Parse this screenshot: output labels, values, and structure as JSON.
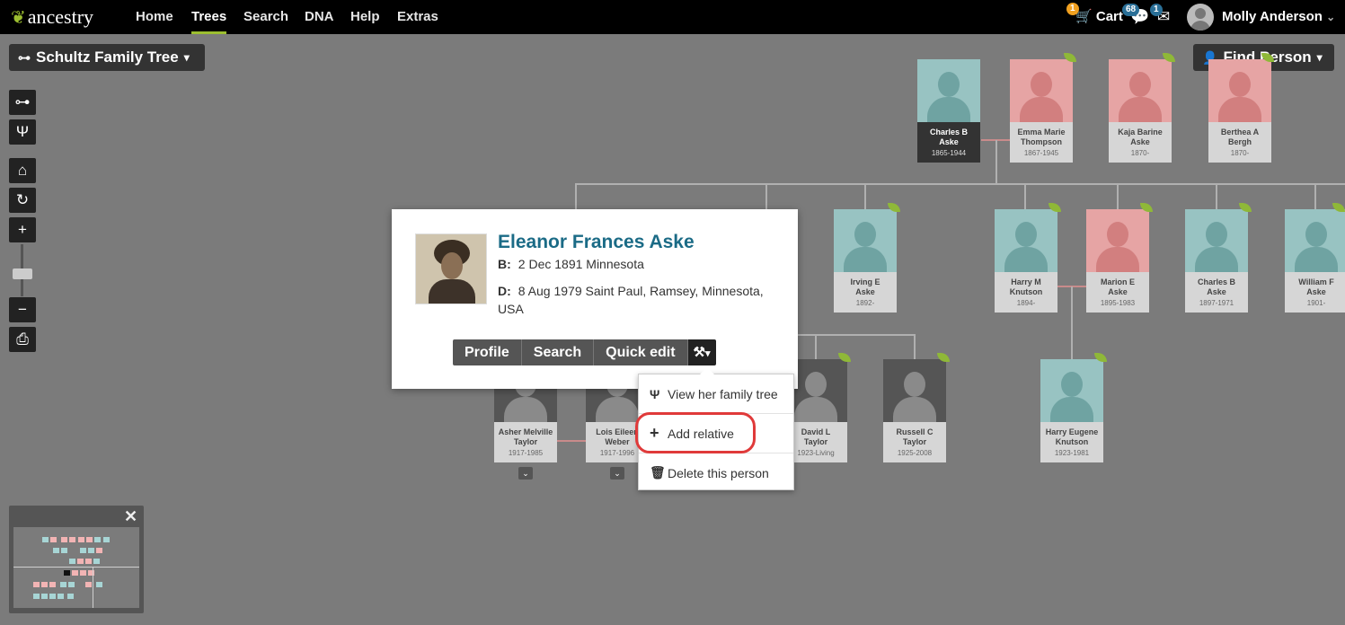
{
  "nav": {
    "logo": "ancestry",
    "links": [
      "Home",
      "Trees",
      "Search",
      "DNA",
      "Help",
      "Extras"
    ],
    "active": "Trees",
    "cart_label": "Cart",
    "cart_count": "1",
    "messages_count": "68",
    "mail_count": "1",
    "user_name": "Molly Anderson"
  },
  "tree_selector": {
    "label": "Schultz Family Tree"
  },
  "find_person": {
    "label": "Find Person"
  },
  "tree_cards": [
    {
      "name": "Charles B\nAske",
      "dates": "1865-1944",
      "gender": "male"
    },
    {
      "name": "Emma Marie\nThompson",
      "dates": "1867-1945",
      "gender": "female"
    },
    {
      "name": "Kaja Barine\nAske",
      "dates": "1870-",
      "gender": "female"
    },
    {
      "name": "Berthea A\nBergh",
      "dates": "1870-",
      "gender": "female"
    },
    {
      "name": "Irving E\nAske",
      "dates": "1892-",
      "gender": "male"
    },
    {
      "name": "Harry M\nKnutson",
      "dates": "1894-",
      "gender": "male"
    },
    {
      "name": "Marion E\nAske",
      "dates": "1895-1983",
      "gender": "female"
    },
    {
      "name": "Charles B\nAske",
      "dates": "1897-1971",
      "gender": "male"
    },
    {
      "name": "William F\nAske",
      "dates": "1901-",
      "gender": "male"
    },
    {
      "name": "Asher Melville\nTaylor",
      "dates": "1917-1985",
      "gender": "photo"
    },
    {
      "name": "Lois Eileen\nWeber",
      "dates": "1917-1996",
      "gender": "photo"
    },
    {
      "name": "David L\nTaylor",
      "dates": "1923-Living",
      "gender": "photo"
    },
    {
      "name": "Russell C\nTaylor",
      "dates": "1925-2008",
      "gender": "photo"
    },
    {
      "name": "Harry Eugene\nKnutson",
      "dates": "1923-1981",
      "gender": "male"
    }
  ],
  "popup": {
    "name": "Eleanor Frances Aske",
    "birth_label": "B:",
    "birth": "2 Dec 1891 Minnesota",
    "death_label": "D:",
    "death": "8 Aug 1979 Saint Paul, Ramsey, Minnesota, USA",
    "actions": [
      "Profile",
      "Search",
      "Quick edit"
    ]
  },
  "menu": {
    "items": [
      "View her family tree",
      "Add relative",
      "Delete this person"
    ],
    "highlighted": "Add relative"
  },
  "colors": {
    "accent_green": "#9cbe30",
    "name_link": "#1b6b86",
    "highlight_ring": "#e03a3a",
    "male_card": "#98c3c2",
    "female_card": "#e6a4a4"
  }
}
